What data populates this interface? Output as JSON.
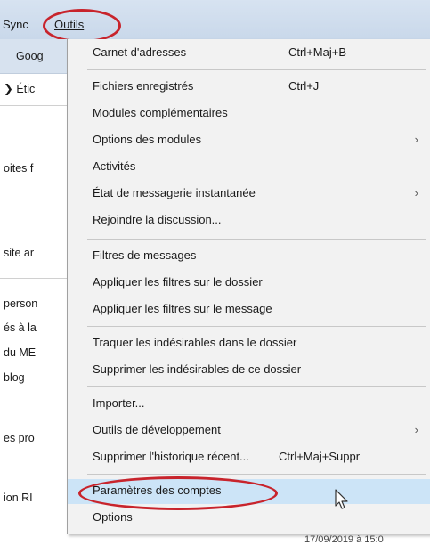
{
  "menubar": {
    "partial_left": "Sync",
    "outils": "Outils"
  },
  "behind": {
    "toolbar_text": "Goog",
    "rows": [
      "Étic",
      "oites f",
      "site ar",
      "person",
      "és à la",
      "du ME",
      "blog",
      "es pro",
      "ion RI"
    ],
    "bottom_date": "17/09/2019 à 15:0"
  },
  "menu": {
    "items": [
      {
        "label": "Carnet d'adresses",
        "shortcut": "Ctrl+Maj+B"
      },
      {
        "label": "Fichiers enregistrés",
        "shortcut": "Ctrl+J"
      },
      {
        "label": "Modules complémentaires"
      },
      {
        "label": "Options des modules",
        "submenu": "›"
      },
      {
        "label": "Activités"
      },
      {
        "label": "État de messagerie instantanée",
        "submenu": "›"
      },
      {
        "label": "Rejoindre la discussion..."
      },
      {
        "label": "Filtres de messages"
      },
      {
        "label": "Appliquer les filtres sur le dossier"
      },
      {
        "label": "Appliquer les filtres sur le message"
      },
      {
        "label": "Traquer les indésirables dans le dossier"
      },
      {
        "label": "Supprimer les indésirables de ce dossier"
      },
      {
        "label": "Importer..."
      },
      {
        "label": "Outils de développement",
        "submenu": "›"
      },
      {
        "label": "Supprimer l'historique récent...",
        "shortcut": "Ctrl+Maj+Suppr"
      },
      {
        "label": "Paramètres des comptes"
      },
      {
        "label": "Options"
      }
    ]
  },
  "colors": {
    "menubar": "#c9d8ea",
    "menu_bg": "#f2f2f2",
    "highlight": "#cce4f7",
    "annotation_red": "#c8242c"
  }
}
